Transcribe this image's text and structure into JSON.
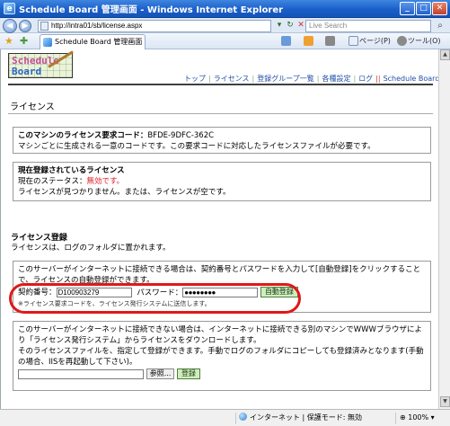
{
  "window": {
    "title": "Schedule Board 管理画面 - Windows Internet Explorer"
  },
  "address_bar": {
    "url": "http://intra01/sb/license.aspx",
    "search_placeholder": "Live Search"
  },
  "tab": {
    "title": "Schedule Board 管理画面"
  },
  "command_bar": {
    "page_menu": "ページ(P)",
    "tools_menu": "ツール(O)"
  },
  "logo": {
    "line1": "Schedule",
    "line2": "Board"
  },
  "top_nav": {
    "items": [
      "トップ",
      "ライセンス",
      "登録グループ一覧",
      "各種設定",
      "ログ"
    ],
    "external_link": "Schedule Board 画面"
  },
  "page": {
    "title": "ライセンス"
  },
  "request_code_panel": {
    "label": "このマシンのライセンス要求コード：",
    "code": "BFDE-9DFC-362C",
    "description": "マシンごとに生成される一意のコードです。この要求コードに対応したライセンスファイルが必要です。"
  },
  "current_license_panel": {
    "heading": "現在登録されているライセンス",
    "status_label": "現在のステータス：",
    "status_value": "無効です。",
    "message": "ライセンスが見つかりません。または、ライセンスが空です。"
  },
  "registration": {
    "title": "ライセンス登録",
    "description": "ライセンスは、ログのフォルダに置かれます。"
  },
  "online_panel": {
    "instructions": "このサーバーがインターネットに接続できる場合は、契約番号とパスワードを入力して[自動登録]をクリックすることで、ライセンスの自動登録ができます。",
    "contract_label": "契約番号：",
    "contract_value": "D100903279",
    "password_label": "パスワード：",
    "password_value": "●●●●●●●●",
    "auto_register_button": "自動登録",
    "note": "※ライセンス要求コードを、ライセンス発行システムに送信します。"
  },
  "offline_panel": {
    "instructions": "このサーバーがインターネットに接続できない場合は、インターネットに接続できる別のマシンでWWWブラウザにより「ライセンス発行システム」からライセンスをダウンロードします。",
    "instructions2": "そのライセンスファイルを、指定して登録ができます。手動でログのフォルダにコピーしても登録済みとなります(手動の場合、IISを再起動して下さい)。",
    "browse_button": "参照...",
    "register_button": "登録"
  },
  "status_bar": {
    "zone": "インターネット | 保護モード: 無効",
    "zoom": "100%"
  },
  "colors": {
    "accent_link": "#1f4fa8",
    "status_invalid": "#e0202a",
    "highlight": "#e01818",
    "green_button": "#cfeec0"
  }
}
